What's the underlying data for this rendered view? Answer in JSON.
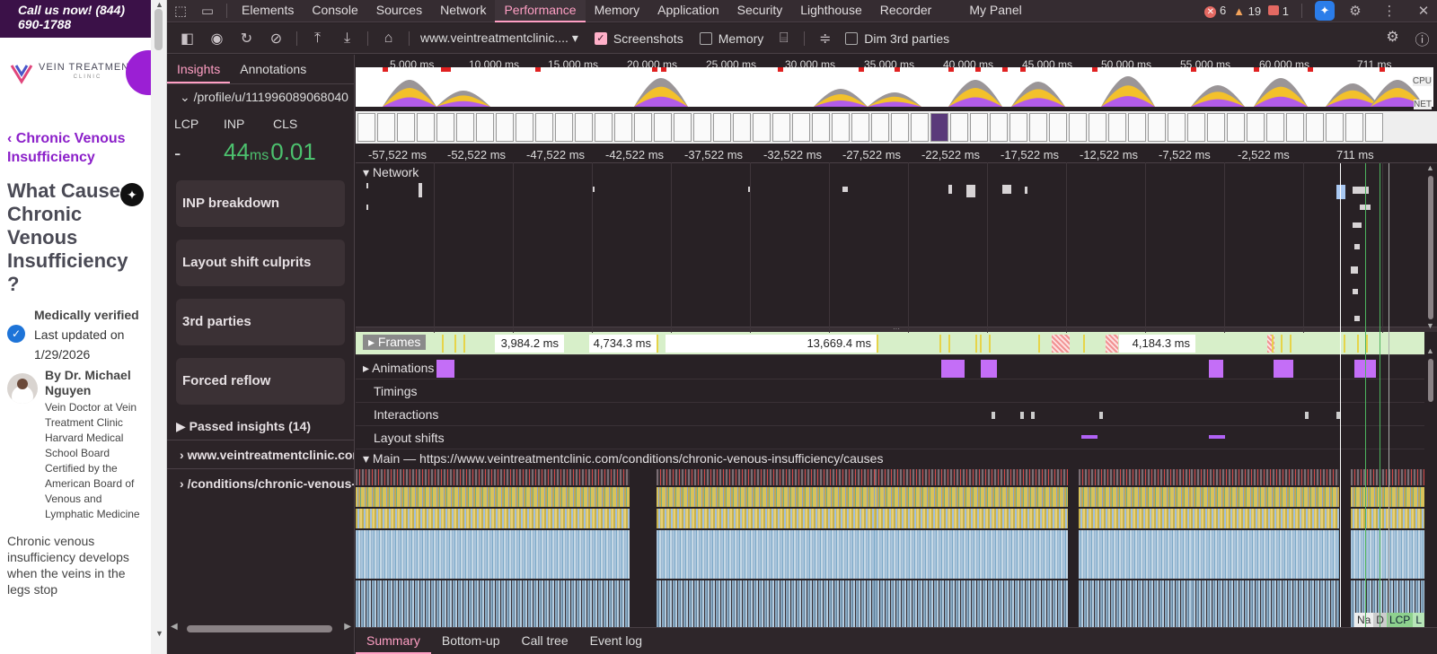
{
  "site": {
    "call_bar": "Call us now! (844) 690-1788",
    "logo_text": "VEIN TREATMENT",
    "logo_sub": "CLINIC",
    "back_link": "Chronic Venous Insufficiency",
    "h1": "What Causes Chronic Venous Insufficiency ?",
    "verified_label": "Medically verified",
    "updated": "Last updated on 1/29/2026",
    "author_name": "By Dr. Michael Nguyen",
    "author_bio": "Vein Doctor at Vein Treatment Clinic Harvard Medical School Board Certified by the American Board of Venous and Lymphatic Medicine",
    "body_text": "Chronic venous insufficiency develops when the veins in the legs stop"
  },
  "devtools": {
    "panel_tabs": [
      "Elements",
      "Console",
      "Sources",
      "Network",
      "Performance",
      "Memory",
      "Application",
      "Security",
      "Lighthouse",
      "Recorder",
      "My Panel"
    ],
    "active_panel": "Performance",
    "errors": "6",
    "warnings": "19",
    "messages": "1",
    "toolbar": {
      "url": "www.veintreatmentclinic....",
      "screenshots": "Screenshots",
      "memory": "Memory",
      "dim": "Dim 3rd parties"
    },
    "sidebar": {
      "tabs": [
        "Insights",
        "Annotations"
      ],
      "trace_path": "/profile/u/111996089068040",
      "metric_labels": [
        "LCP",
        "INP",
        "CLS"
      ],
      "lcp_value": "-",
      "inp_value": "44",
      "inp_unit": "ms",
      "cls_value": "0.01",
      "insights": [
        "INP breakdown",
        "Layout shift culprits",
        "3rd parties",
        "Forced reflow"
      ],
      "passed": "Passed insights (14)",
      "trace_items": [
        "www.veintreatmentclinic.com",
        "/conditions/chronic-venous-insufficiency"
      ]
    },
    "overview_ticks": [
      "5.000 ms",
      "10.000 ms",
      "15.000 ms",
      "20.000 ms",
      "25.000 ms",
      "30.000 ms",
      "35.000 ms",
      "40.000 ms",
      "45.000 ms",
      "50.000 ms",
      "55.000 ms",
      "60.000 ms",
      "711 ms"
    ],
    "cpu_label": "CPU",
    "net_label": "NET",
    "main_ticks": [
      "-57,522 ms",
      "-52,522 ms",
      "-47,522 ms",
      "-42,522 ms",
      "-37,522 ms",
      "-32,522 ms",
      "-27,522 ms",
      "-22,522 ms",
      "-17,522 ms",
      "-12,522 ms",
      "-7,522 ms",
      "-2,522 ms",
      "711 ms"
    ],
    "tracks": {
      "network": "Network",
      "frames": "Frames",
      "animations": "Animations",
      "timings": "Timings",
      "interactions": "Interactions",
      "layout_shifts": "Layout shifts",
      "main": "Main — https://www.veintreatmentclinic.com/conditions/chronic-venous-insufficiency/causes"
    },
    "frame_labels": [
      "3,984.2 ms",
      "4,734.3 ms",
      "13,669.4 ms",
      "4,184.3 ms"
    ],
    "markers": [
      "Na",
      "D",
      "LCP",
      "L"
    ],
    "bottom_tabs": [
      "Summary",
      "Bottom-up",
      "Call tree",
      "Event log"
    ]
  }
}
